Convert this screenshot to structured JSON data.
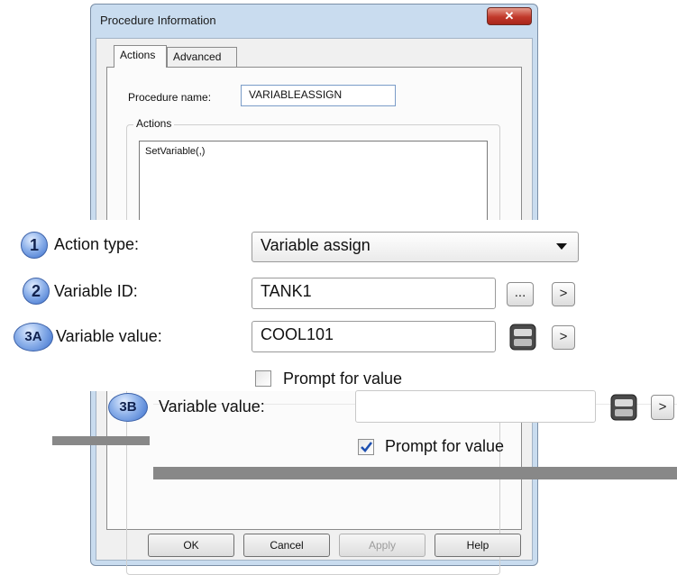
{
  "dialog": {
    "title": "Procedure Information",
    "close_symbol": "✕",
    "tabs": [
      {
        "label": "Actions",
        "selected": true
      },
      {
        "label": "Advanced",
        "selected": false
      }
    ],
    "procedure_name_label": "Procedure name:",
    "procedure_name_value": "VARIABLEASSIGN",
    "actions_group_label": "Actions",
    "actions_list": [
      "SetVariable(,)"
    ],
    "buttons": {
      "ok": "OK",
      "cancel": "Cancel",
      "apply": "Apply",
      "help": "Help"
    }
  },
  "callouts": {
    "step1": {
      "badge": "1",
      "label": "Action type:",
      "value": "Variable assign",
      "icon": "chevron-down-icon"
    },
    "step2": {
      "badge": "2",
      "label": "Variable ID:",
      "value": "TANK1",
      "browse_button": "...",
      "arrow_button": ">"
    },
    "step3a": {
      "badge": "3A",
      "label": "Variable value:",
      "value": "COOL101",
      "icon": "keypad-icon",
      "arrow_button": ">",
      "prompt_label": "Prompt for value",
      "prompt_checked": false
    },
    "step3b": {
      "badge": "3B",
      "label": "Variable value:",
      "value": "",
      "icon": "keypad-icon",
      "arrow_button": ">",
      "prompt_label": "Prompt for value",
      "prompt_checked": true
    }
  }
}
